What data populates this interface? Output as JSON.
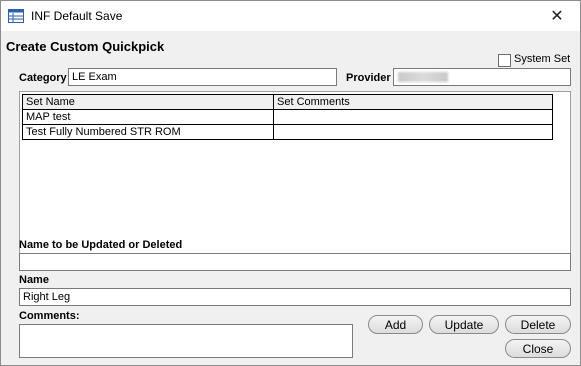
{
  "window": {
    "title": "INF Default Save"
  },
  "form": {
    "heading": "Create Custom Quickpick",
    "system_set_label": "System Set",
    "category_label": "Category",
    "category_value": "LE Exam",
    "provider_label": "Provider",
    "grid": {
      "columns": [
        "Set Name",
        "Set Comments"
      ],
      "rows": [
        [
          "MAP test",
          ""
        ],
        [
          "Test Fully Numbered STR ROM",
          ""
        ]
      ]
    },
    "update_delete_label": "Name to be Updated or Deleted",
    "update_delete_value": "",
    "name_label": "Name",
    "name_value": "Right Leg",
    "comments_label": "Comments:"
  },
  "buttons": {
    "add": "Add",
    "update": "Update",
    "delete": "Delete",
    "close": "Close"
  }
}
